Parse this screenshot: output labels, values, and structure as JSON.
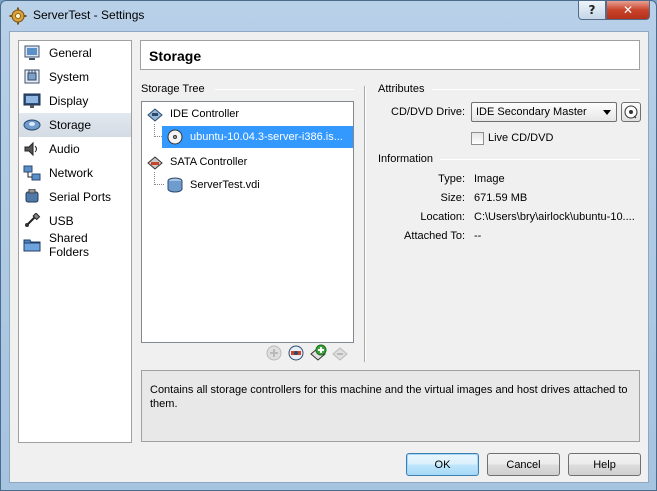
{
  "window": {
    "title": "ServerTest - Settings",
    "help_glyph": "?",
    "close_glyph": "✕"
  },
  "sidebar": {
    "items": [
      {
        "label": "General",
        "icon": "general-icon"
      },
      {
        "label": "System",
        "icon": "system-icon"
      },
      {
        "label": "Display",
        "icon": "display-icon"
      },
      {
        "label": "Storage",
        "icon": "storage-icon",
        "selected": true
      },
      {
        "label": "Audio",
        "icon": "audio-icon"
      },
      {
        "label": "Network",
        "icon": "network-icon"
      },
      {
        "label": "Serial Ports",
        "icon": "serial-ports-icon"
      },
      {
        "label": "USB",
        "icon": "usb-icon"
      },
      {
        "label": "Shared Folders",
        "icon": "shared-folders-icon"
      }
    ]
  },
  "page": {
    "heading": "Storage"
  },
  "storage_tree": {
    "label": "Storage Tree",
    "ide_controller": "IDE Controller",
    "ide_attachment": "ubuntu-10.04.3-server-i386.is...",
    "sata_controller": "SATA Controller",
    "sata_attachment": "ServerTest.vdi"
  },
  "attributes": {
    "label": "Attributes",
    "drive_label": "CD/DVD Drive:",
    "drive_value": "IDE Secondary Master",
    "live_cd_label": "Live CD/DVD",
    "live_cd_checked": false
  },
  "information": {
    "label": "Information",
    "type_label": "Type:",
    "type_value": "Image",
    "size_label": "Size:",
    "size_value": "671.59 MB",
    "location_label": "Location:",
    "location_value": "C:\\Users\\bry\\airlock\\ubuntu-10....",
    "attached_label": "Attached To:",
    "attached_value": "--"
  },
  "description": "Contains all storage controllers for this machine and the virtual images and host drives attached to them.",
  "buttons": {
    "ok": "OK",
    "cancel": "Cancel",
    "help": "Help"
  },
  "colors": {
    "selection": "#3399ff",
    "title_bar": "#b8d0e8",
    "close_button": "#c9442b"
  }
}
